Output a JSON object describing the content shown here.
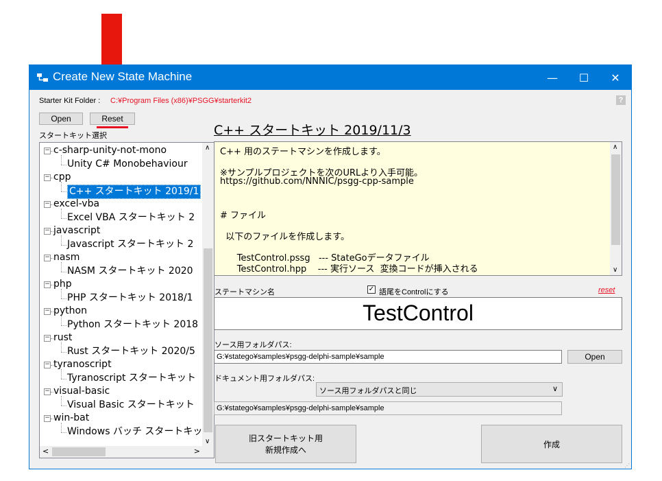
{
  "window": {
    "title": "Create New State Machine",
    "controls": {
      "minimize": "—",
      "maximize": "☐",
      "close": "✕"
    }
  },
  "starter_kit_folder": {
    "label": "Starter Kit Folder :",
    "path": "C:¥Program Files (x86)¥PSGG¥starterkit2"
  },
  "buttons": {
    "open": "Open",
    "reset": "Reset",
    "help": "?"
  },
  "tree": {
    "label": "スタートキット選択",
    "items": [
      {
        "text": "c-sharp-unity-not-mono",
        "level": 0
      },
      {
        "text": "Unity C# Monobehaviour",
        "level": 1
      },
      {
        "text": "cpp",
        "level": 0
      },
      {
        "text": "C++ スタートキット 2019/1",
        "level": 1,
        "selected": true
      },
      {
        "text": "excel-vba",
        "level": 0
      },
      {
        "text": "Excel VBA スタートキット 2",
        "level": 1
      },
      {
        "text": "javascript",
        "level": 0
      },
      {
        "text": "Javascript スタートキット 2",
        "level": 1
      },
      {
        "text": "nasm",
        "level": 0
      },
      {
        "text": "NASM スタートキット 2020",
        "level": 1
      },
      {
        "text": "php",
        "level": 0
      },
      {
        "text": "PHP スタートキット 2018/1",
        "level": 1
      },
      {
        "text": "python",
        "level": 0
      },
      {
        "text": "Python スタートキット 2018",
        "level": 1
      },
      {
        "text": "rust",
        "level": 0
      },
      {
        "text": "Rust スタートキット 2020/5",
        "level": 1
      },
      {
        "text": "tyranoscript",
        "level": 0
      },
      {
        "text": "Tyranoscript スタートキット",
        "level": 1
      },
      {
        "text": "visual-basic",
        "level": 0
      },
      {
        "text": "Visual Basic スタートキット",
        "level": 1
      },
      {
        "text": "win-bat",
        "level": 0
      },
      {
        "text": "Windows バッチ スタートキッ",
        "level": 1
      }
    ]
  },
  "kit_title": "C++ スタートキット 2019/11/3",
  "description": [
    "C++ 用のステートマシンを作成します。",
    "",
    "※サンプルプロジェクトを次のURLより入手可能。",
    "https://github.com/NNNIC/psgg-cpp-sample",
    "",
    "",
    "# ファイル",
    "",
    "  以下のファイルを作成します。",
    "",
    "      TestControl.pssg   --- StateGoデータファイル",
    "      TestControl.hpp    --- 実行ソース  変換コードが挿入される"
  ],
  "state_machine": {
    "label": "ステートマシン名",
    "suffix_checkbox_label": "語尾をControlにする",
    "suffix_checked": true,
    "reset_link": "reset",
    "name": "TestControl"
  },
  "source_folder": {
    "label": "ソース用フォルダパス:",
    "path": "G:¥statego¥samples¥psgg-delphi-sample¥sample",
    "open_button": "Open"
  },
  "document_folder": {
    "label": "ドキュメント用フォルダパス:",
    "select_value": "ソース用フォルダパスと同じ",
    "path": "G:¥statego¥samples¥psgg-delphi-sample¥sample"
  },
  "actions": {
    "old_kit": "旧スタートキット用\n新規作成へ",
    "create": "作成"
  },
  "colors": {
    "accent": "#0078d7",
    "annotation_arrow": "#e8170e",
    "path_red": "#e81123"
  }
}
